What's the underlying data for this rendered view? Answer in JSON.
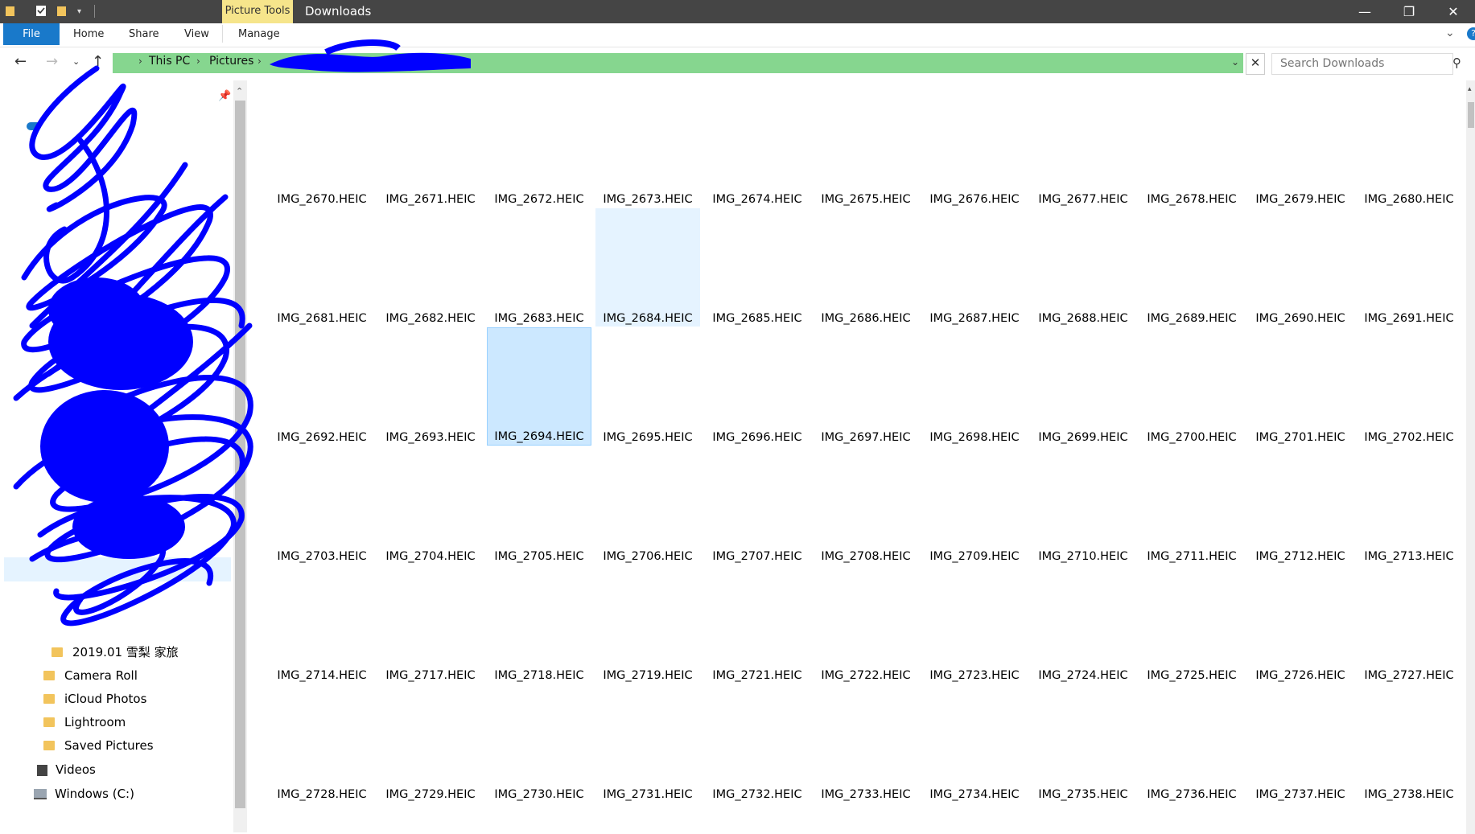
{
  "titlebar": {
    "context_tab": "Picture Tools",
    "title": "Downloads",
    "minimize": "—",
    "maximize": "❐",
    "close": "✕"
  },
  "ribbon": {
    "tabs": [
      "File",
      "Home",
      "Share",
      "View",
      "Manage"
    ]
  },
  "nav": {
    "back": "←",
    "forward": "→",
    "recent": "⌄",
    "up": "↑"
  },
  "address": {
    "breadcrumbs": [
      "This PC",
      "Pictures"
    ],
    "separator": "›"
  },
  "search": {
    "placeholder": "Search Downloads"
  },
  "sidebar": {
    "items": [
      {
        "label": "2019.01 雪梨 家旅",
        "icon": "folder-icon"
      },
      {
        "label": "Camera Roll",
        "icon": "folder-icon"
      },
      {
        "label": "iCloud Photos",
        "icon": "folder-icon"
      },
      {
        "label": "Lightroom",
        "icon": "folder-icon"
      },
      {
        "label": "Saved Pictures",
        "icon": "folder-icon"
      },
      {
        "label": "Videos",
        "icon": "videos-icon"
      },
      {
        "label": "Windows (C:)",
        "icon": "drive-icon"
      }
    ]
  },
  "files": {
    "selected": "IMG_2694.HEIC",
    "hovered": "IMG_2684.HEIC",
    "rows": [
      [
        "IMG_2670.HEIC",
        "IMG_2671.HEIC",
        "IMG_2672.HEIC",
        "IMG_2673.HEIC",
        "IMG_2674.HEIC",
        "IMG_2675.HEIC",
        "IMG_2676.HEIC",
        "IMG_2677.HEIC",
        "IMG_2678.HEIC",
        "IMG_2679.HEIC",
        "IMG_2680.HEIC"
      ],
      [
        "IMG_2681.HEIC",
        "IMG_2682.HEIC",
        "IMG_2683.HEIC",
        "IMG_2684.HEIC",
        "IMG_2685.HEIC",
        "IMG_2686.HEIC",
        "IMG_2687.HEIC",
        "IMG_2688.HEIC",
        "IMG_2689.HEIC",
        "IMG_2690.HEIC",
        "IMG_2691.HEIC"
      ],
      [
        "IMG_2692.HEIC",
        "IMG_2693.HEIC",
        "IMG_2694.HEIC",
        "IMG_2695.HEIC",
        "IMG_2696.HEIC",
        "IMG_2697.HEIC",
        "IMG_2698.HEIC",
        "IMG_2699.HEIC",
        "IMG_2700.HEIC",
        "IMG_2701.HEIC",
        "IMG_2702.HEIC"
      ],
      [
        "IMG_2703.HEIC",
        "IMG_2704.HEIC",
        "IMG_2705.HEIC",
        "IMG_2706.HEIC",
        "IMG_2707.HEIC",
        "IMG_2708.HEIC",
        "IMG_2709.HEIC",
        "IMG_2710.HEIC",
        "IMG_2711.HEIC",
        "IMG_2712.HEIC",
        "IMG_2713.HEIC"
      ],
      [
        "IMG_2714.HEIC",
        "IMG_2717.HEIC",
        "IMG_2718.HEIC",
        "IMG_2719.HEIC",
        "IMG_2721.HEIC",
        "IMG_2722.HEIC",
        "IMG_2723.HEIC",
        "IMG_2724.HEIC",
        "IMG_2725.HEIC",
        "IMG_2726.HEIC",
        "IMG_2727.HEIC"
      ],
      [
        "IMG_2728.HEIC",
        "IMG_2729.HEIC",
        "IMG_2730.HEIC",
        "IMG_2731.HEIC",
        "IMG_2732.HEIC",
        "IMG_2733.HEIC",
        "IMG_2734.HEIC",
        "IMG_2735.HEIC",
        "IMG_2736.HEIC",
        "IMG_2737.HEIC",
        "IMG_2738.HEIC"
      ]
    ]
  },
  "colors": {
    "titlebar_bg": "#454545",
    "context_tab_bg": "#f6e58b",
    "file_tab_bg": "#1979ca",
    "address_bar_bg": "#86d68f",
    "selection_bg": "#cce8ff",
    "hover_bg": "#e5f3ff",
    "scribble": "#0000ff"
  }
}
